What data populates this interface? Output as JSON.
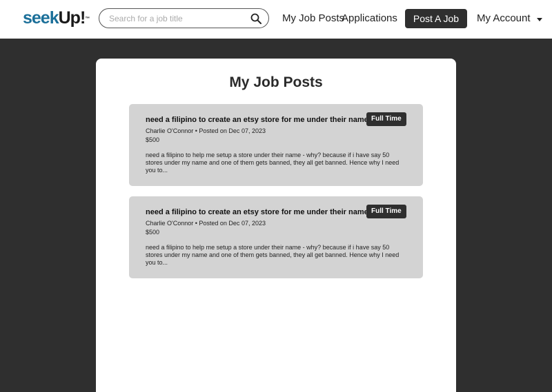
{
  "header": {
    "logo": {
      "seek": "seek",
      "up": "Up!",
      "tm": "™"
    },
    "search": {
      "placeholder": "Search for a job title",
      "value": ""
    },
    "nav": {
      "my_job_posts": "My Job Posts",
      "applications": "Applications"
    },
    "post_job_label": "Post A Job",
    "account_label": "My Account"
  },
  "page": {
    "title": "My Job Posts"
  },
  "posts": [
    {
      "title": "need a filipino to create an etsy store for me under their name",
      "type": "Full Time",
      "meta": "Charlie O'Connor • Posted on Dec 07, 2023",
      "price": "$500",
      "description": "need a filipino to help me setup a store under their name - why? because if i have say 50 stores under my name and one of them gets banned, they all get banned. Hence why I need you to..."
    },
    {
      "title": "need a filipino to create an etsy store for me under their name",
      "type": "Full Time",
      "meta": "Charlie O'Connor • Posted on Dec 07, 2023",
      "price": "$500",
      "description": "need a filipino to help me setup a store under their name - why? because if i have say 50 stores under my name and one of them gets banned, they all get banned. Hence why I need you to..."
    }
  ],
  "colors": {
    "brand": "#1b6f99",
    "dark": "#2f2f2f",
    "card": "#d3d3d3"
  }
}
